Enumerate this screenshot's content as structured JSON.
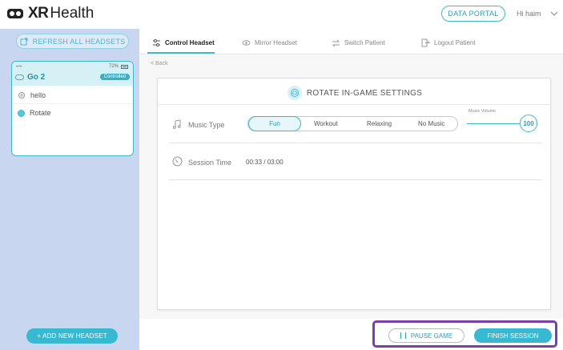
{
  "header": {
    "logo_bold": "XR",
    "logo_regular": "Health",
    "portal_label": "DATA PORTAL",
    "greeting": "Hi haim"
  },
  "sidebar": {
    "refresh_label": "REFRESH ALL HEADSETS",
    "headset": {
      "dots": "•••",
      "battery": "72%",
      "name": "Go 2",
      "status": "Controlled",
      "items": [
        {
          "label": "hello",
          "icon": "gear-icon"
        },
        {
          "label": "Rotate",
          "icon": "dot-icon"
        }
      ]
    },
    "add_label": "+ ADD NEW HEADSET"
  },
  "tabs": [
    {
      "label": "Control Headset",
      "icon": "sliders-icon",
      "active": true
    },
    {
      "label": "Mirror Headset",
      "icon": "eye-icon",
      "active": false
    },
    {
      "label": "Switch Patient",
      "icon": "swap-icon",
      "active": false
    },
    {
      "label": "Logout Patient",
      "icon": "logout-icon",
      "active": false
    }
  ],
  "main": {
    "back_label": "< Back",
    "panel_title": "ROTATE IN-GAME SETTINGS",
    "music": {
      "label": "Music Type",
      "options": [
        "Fun",
        "Workout",
        "Relaxing",
        "No Music"
      ],
      "selected": "Fun",
      "volume_label": "Music Volume",
      "volume_value": "100"
    },
    "session": {
      "label": "Session Time",
      "value": "00:33 / 03:00"
    }
  },
  "actions": {
    "pause_label": "PAUSE GAME",
    "finish_label": "FINISH SESSION"
  },
  "colors": {
    "accent": "#3fb8cf",
    "sidebar_bg": "#c9d6f0",
    "highlight_box": "#7a3fa8"
  }
}
